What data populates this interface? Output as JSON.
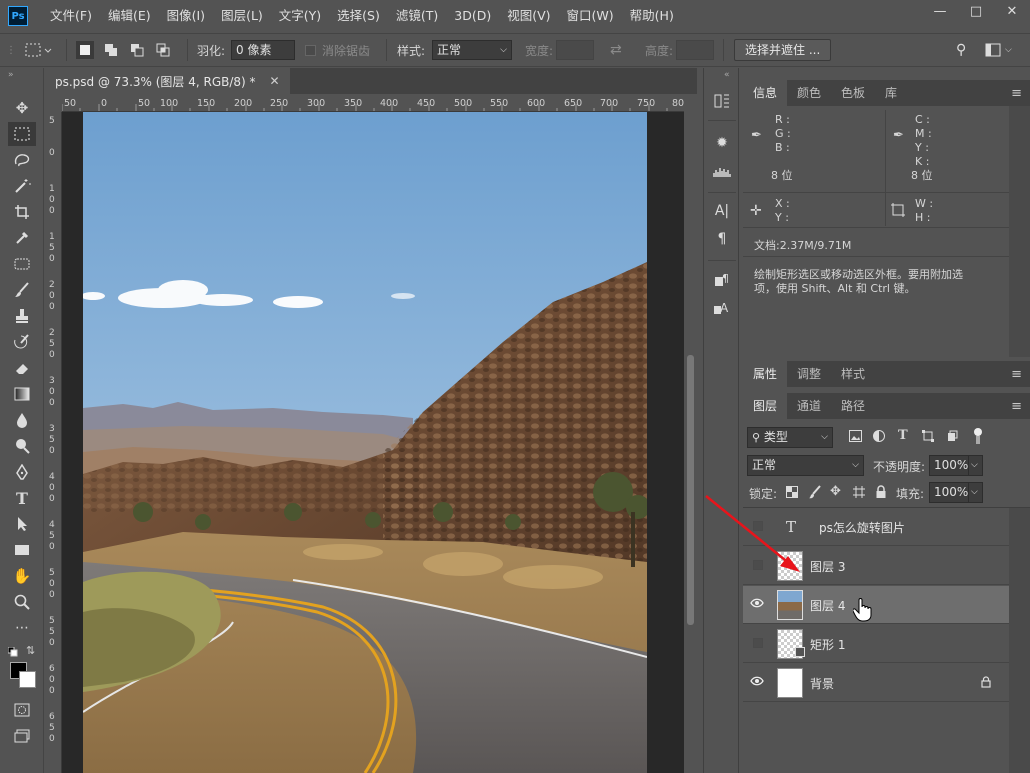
{
  "app": {
    "logo": "Ps",
    "menu": [
      "文件(F)",
      "编辑(E)",
      "图像(I)",
      "图层(L)",
      "文字(Y)",
      "选择(S)",
      "滤镜(T)",
      "3D(D)",
      "视图(V)",
      "窗口(W)",
      "帮助(H)"
    ],
    "window_controls": [
      "minimize-icon",
      "restore-icon",
      "close-icon"
    ]
  },
  "options": {
    "feather_label": "羽化:",
    "feather_value": "0 像素",
    "antialias_label": "消除锯齿",
    "style_label": "样式:",
    "style_value": "正常",
    "width_label": "宽度:",
    "height_label": "高度:",
    "select_mask_button": "选择并遮住 ..."
  },
  "document": {
    "tab_title": "ps.psd @ 73.3% (图层 4, RGB/8) *",
    "ruler_h": [
      "50",
      "0",
      "50",
      "100",
      "150",
      "200",
      "250",
      "300",
      "350",
      "400",
      "450",
      "500",
      "550",
      "600",
      "650",
      "700",
      "750",
      "80"
    ],
    "ruler_v": [
      "5",
      "0",
      "1 0 0",
      "1 5 0",
      "2 0 0",
      "2 5 0",
      "3 0 0",
      "3 5 0",
      "4 0 0",
      "4 5 0",
      "5 0 0",
      "5 5 0",
      "6 0 0",
      "6 5 0"
    ]
  },
  "info_panel": {
    "tabs": [
      "信息",
      "颜色",
      "色板",
      "库"
    ],
    "rgb_labels": [
      "R :",
      "G :",
      "B :"
    ],
    "bit_left": "8 位",
    "cmyk_labels": [
      "C :",
      "M :",
      "Y :",
      "K :"
    ],
    "bit_right": "8 位",
    "xy_labels": [
      "X :",
      "Y :"
    ],
    "wh_labels": [
      "W :",
      "H :"
    ],
    "doc_size": "文档:2.37M/9.71M",
    "hint_line1": "绘制矩形选区或移动选区外框。要用附加选",
    "hint_line2": "项，使用 Shift、Alt 和 Ctrl 键。"
  },
  "properties_panel": {
    "tabs": [
      "属性",
      "调整",
      "样式"
    ]
  },
  "layers_panel": {
    "tabs": [
      "图层",
      "通道",
      "路径"
    ],
    "filter_kind": "类型",
    "blend_mode": "正常",
    "opacity_label": "不透明度:",
    "opacity_value": "100%",
    "lock_label": "锁定:",
    "fill_label": "填充:",
    "fill_value": "100%",
    "layers": [
      {
        "name": "ps怎么旋转图片",
        "kind": "text",
        "visible": false,
        "selected": false
      },
      {
        "name": "图层 3",
        "kind": "pixel",
        "visible": false,
        "selected": false
      },
      {
        "name": "图层 4",
        "kind": "photo",
        "visible": true,
        "selected": true
      },
      {
        "name": "矩形 1",
        "kind": "shape",
        "visible": false,
        "selected": false
      },
      {
        "name": "背景",
        "kind": "background",
        "visible": true,
        "selected": false,
        "locked": true
      }
    ]
  },
  "colors": {
    "accent": "#31a8ff",
    "annotation_arrow": "#e8141b"
  }
}
